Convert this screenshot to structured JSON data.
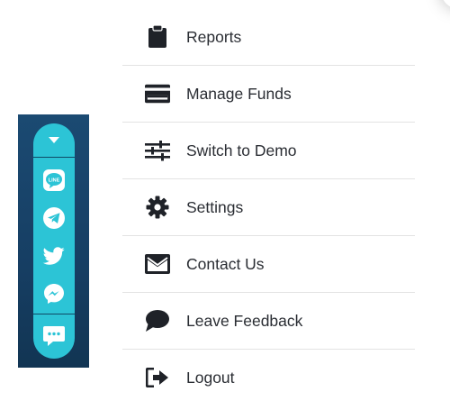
{
  "social_widget": {
    "toggle_icon": "caret-down-icon",
    "buttons": [
      {
        "name": "line",
        "icon": "line-icon"
      },
      {
        "name": "telegram",
        "icon": "telegram-icon"
      },
      {
        "name": "twitter",
        "icon": "twitter-icon"
      },
      {
        "name": "messenger",
        "icon": "messenger-icon"
      },
      {
        "name": "chat",
        "icon": "chat-icon"
      }
    ],
    "line_icon_text": "LINE",
    "colors": {
      "panel": "#1b4a72",
      "pill": "#2cc4d6",
      "icon": "#ffffff"
    }
  },
  "menu": {
    "items": [
      {
        "label": "Reports",
        "icon": "clipboard-icon"
      },
      {
        "label": "Manage Funds",
        "icon": "credit-card-icon"
      },
      {
        "label": "Switch to Demo",
        "icon": "sliders-icon"
      },
      {
        "label": "Settings",
        "icon": "gear-icon"
      },
      {
        "label": "Contact Us",
        "icon": "envelope-icon"
      },
      {
        "label": "Leave Feedback",
        "icon": "speech-bubble-icon"
      },
      {
        "label": "Logout",
        "icon": "sign-out-icon"
      }
    ],
    "colors": {
      "text": "#2a2d33",
      "icon": "#1f2228",
      "divider": "#e3e3e3"
    }
  }
}
